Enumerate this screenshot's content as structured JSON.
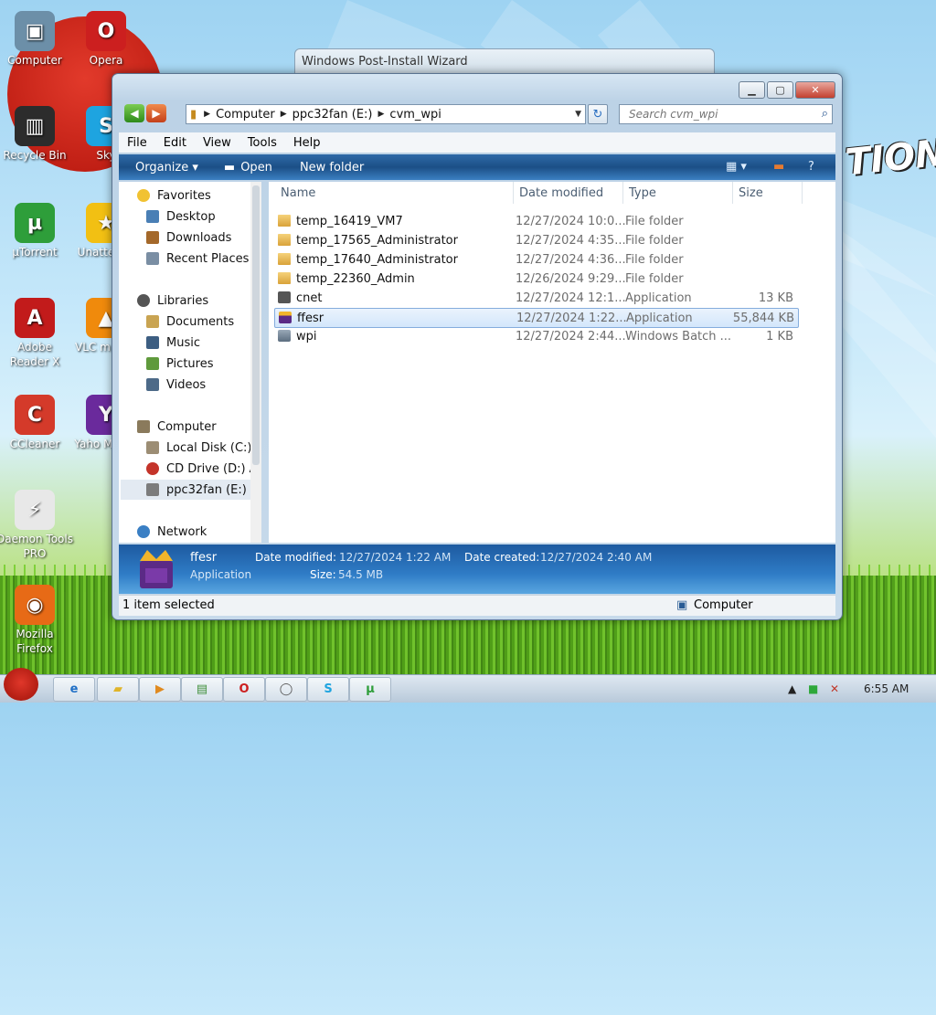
{
  "desktop": {
    "icons": [
      {
        "label": "Computer",
        "icon": "computer-icon",
        "color": "#6c8fa8",
        "glyph": "▣"
      },
      {
        "label": "Opera",
        "icon": "opera-icon",
        "color": "#cc1f1f",
        "glyph": "O"
      },
      {
        "label": "Recycle Bin",
        "icon": "recycle-bin-icon",
        "color": "#2c2c2c",
        "glyph": "▥"
      },
      {
        "label": "Sky",
        "icon": "skype-icon",
        "color": "#1ea4e0",
        "glyph": "S"
      },
      {
        "label": "µTorrent",
        "icon": "utorrent-icon",
        "color": "#2e9e3a",
        "glyph": "µ"
      },
      {
        "label": "Unatte Sol",
        "icon": "unattended-icon",
        "color": "#f2c013",
        "glyph": "★"
      },
      {
        "label": "Adobe Reader X",
        "icon": "adobe-reader-icon",
        "color": "#c21b1b",
        "glyph": "A"
      },
      {
        "label": "VLC m play",
        "icon": "vlc-icon",
        "color": "#f08a0c",
        "glyph": "▲"
      },
      {
        "label": "CCleaner",
        "icon": "ccleaner-icon",
        "color": "#d43a2a",
        "glyph": "C"
      },
      {
        "label": "Yaho Messe",
        "icon": "yahoo-icon",
        "color": "#6a2a9c",
        "glyph": "Y"
      },
      {
        "label": "Daemon Tools PRO",
        "icon": "daemon-tools-icon",
        "color": "#e8e8e8",
        "glyph": "⚡"
      },
      {
        "label": "Mozilla Firefox",
        "icon": "firefox-icon",
        "color": "#e76a16",
        "glyph": "◉"
      }
    ],
    "wallpaper_text": "TION"
  },
  "back_window": {
    "title": "Windows Post-Install Wizard"
  },
  "window": {
    "address": {
      "crumbs": [
        "Computer",
        "ppc32fan (E:)",
        "cvm_wpi"
      ]
    },
    "search_placeholder": "Search cvm_wpi",
    "menu": [
      "File",
      "Edit",
      "View",
      "Tools",
      "Help"
    ],
    "commands": {
      "organize": "Organize ▾",
      "open": "Open",
      "new_folder": "New folder"
    },
    "nav": {
      "favorites": "Favorites",
      "desktop": "Desktop",
      "downloads": "Downloads",
      "recent": "Recent Places",
      "libraries": "Libraries",
      "documents": "Documents",
      "music": "Music",
      "pictures": "Pictures",
      "videos": "Videos",
      "computer": "Computer",
      "local_disk": "Local Disk (C:)",
      "cd_drive": "CD Drive (D:) A",
      "ppc32fan": "ppc32fan (E:)",
      "network": "Network"
    },
    "columns": {
      "name": "Name",
      "date": "Date modified",
      "type": "Type",
      "size": "Size"
    },
    "files": [
      {
        "name": "temp_16419_VM7",
        "date": "12/27/2024 10:0...",
        "type": "File folder",
        "size": "",
        "icon": "folder"
      },
      {
        "name": "temp_17565_Administrator",
        "date": "12/27/2024 4:35...",
        "type": "File folder",
        "size": "",
        "icon": "folder"
      },
      {
        "name": "temp_17640_Administrator",
        "date": "12/27/2024 4:36...",
        "type": "File folder",
        "size": "",
        "icon": "folder"
      },
      {
        "name": "temp_22360_Admin",
        "date": "12/26/2024 9:29...",
        "type": "File folder",
        "size": "",
        "icon": "folder"
      },
      {
        "name": "cnet",
        "date": "12/27/2024 12:1...",
        "type": "Application",
        "size": "13 KB",
        "icon": "app"
      },
      {
        "name": "ffesr",
        "date": "12/27/2024 1:22...",
        "type": "Application",
        "size": "55,844 KB",
        "icon": "ffesr"
      },
      {
        "name": "wpi",
        "date": "12/27/2024 2:44...",
        "type": "Windows Batch ...",
        "size": "1 KB",
        "icon": "batch"
      }
    ],
    "selected_index": 5,
    "details": {
      "name": "ffesr",
      "kind": "Application",
      "modified_label": "Date modified:",
      "modified_value": "12/27/2024 1:22 AM",
      "created_label": "Date created:",
      "created_value": "12/27/2024 2:40 AM",
      "size_label": "Size:",
      "size_value": "54.5 MB"
    },
    "status": {
      "left": "1 item selected",
      "right": "Computer"
    }
  },
  "taskbar": {
    "clock": "6:55 AM"
  },
  "colors": {
    "accent": "#1c4f86",
    "selection": "#d3e6fb",
    "folder": "#e8b74a"
  }
}
